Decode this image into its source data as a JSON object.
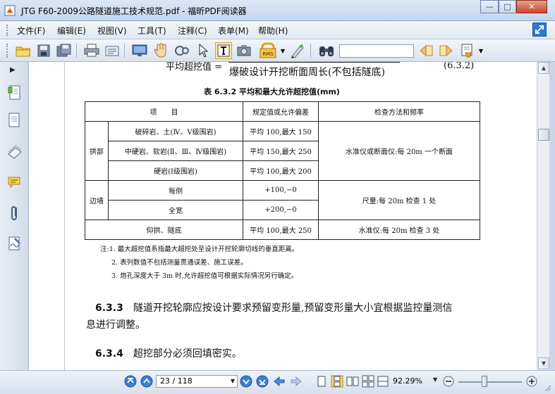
{
  "window": {
    "title": "JTG F60-2009公路隧道施工技术规范.pdf - 福昕PDF阅读器",
    "minimize": "—",
    "maximize": "□",
    "close": "✕"
  },
  "menu": [
    "文件(F)",
    "编辑(E)",
    "视图(V)",
    "工具(T)",
    "注释(C)",
    "表单(M)",
    "帮助(H)"
  ],
  "toolbar": {
    "icons": [
      "open-folder-icon",
      "save-icon",
      "save-as-icon",
      "print-icon",
      "email-icon",
      "fullscreen-icon",
      "hand-tool-icon",
      "zoom-tool-icon",
      "select-arrow-icon",
      "text-select-icon",
      "snapshot-icon",
      "rms-icon",
      "typewriter-icon",
      "find-binoculars-icon",
      "prev-result-icon",
      "next-result-icon",
      "highlight-icon"
    ],
    "rms_label": "RMS",
    "search_value": ""
  },
  "document": {
    "formula_left": "平均超挖值 =",
    "formula_denominator": "爆破设计开挖断面周长(不包括隧底)",
    "formula_number": "(6.3.2)",
    "table_caption": "表 6.3.2   平均和最大允许超挖值(mm)",
    "table": {
      "headers": [
        "项　　目",
        "规定值或允许偏差",
        "检查方法和频率"
      ],
      "groups": [
        {
          "name": "拱部",
          "rows": [
            {
              "item": "破碎岩、土(Ⅳ、Ⅴ级围岩)",
              "value": "平均 100,最大 150"
            },
            {
              "item": "中硬岩、软岩(Ⅱ、Ⅲ、Ⅳ级围岩)",
              "value": "平均 150,最大 250"
            },
            {
              "item": "硬岩(Ⅰ级围岩)",
              "value": "平均 100,最大 200"
            }
          ],
          "method": "水准仪或断面仪:每 20m 一个断面"
        },
        {
          "name": "边墙",
          "rows": [
            {
              "item": "每侧",
              "value": "+100,−0"
            },
            {
              "item": "全宽",
              "value": "+200,−0"
            }
          ],
          "method": "尺量:每 20m 检查 1 处"
        }
      ],
      "last_row": {
        "item": "仰拱、隧底",
        "value": "平均 100,最大 250",
        "method": "水准仪:每 20m 检查 3 处"
      }
    },
    "notes": [
      "注:1. 最大超挖值系指最大超挖处至设计开挖轮廓切线的垂直距离。",
      "2. 表列数值不包括测量贯通误差、施工误差。",
      "3. 炮孔深度大于 3m 时,允许超挖值可根据实际情况另行确定。"
    ],
    "clause_633_num": "6.3.3",
    "clause_633_line1": "隧道开挖轮廓应按设计要求预留变形量,预留变形量大小宜根据监控量测信",
    "clause_633_line2": "息进行调整。",
    "clause_634_num": "6.3.4",
    "clause_634_text": "超挖部分必须回填密实。"
  },
  "status": {
    "page_current": "23",
    "page_total": "118",
    "page_display": "23 / 118",
    "zoom": "92.29%"
  }
}
